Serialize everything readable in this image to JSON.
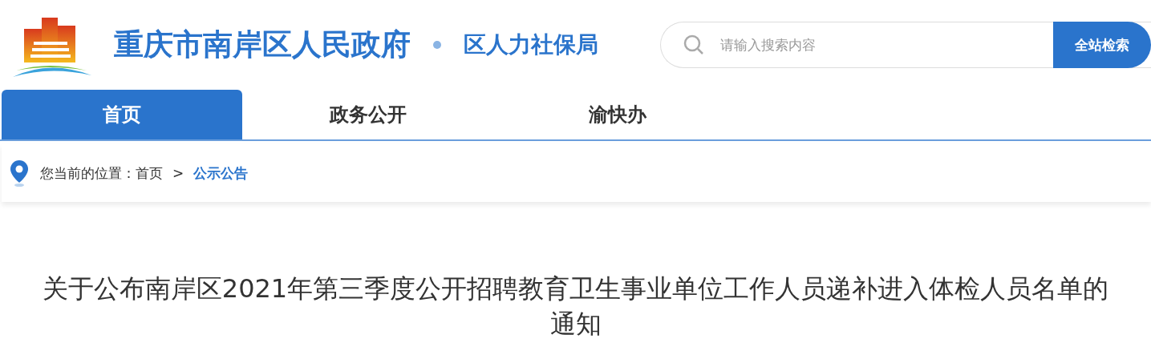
{
  "header": {
    "site_name": "重庆市南岸区人民政府",
    "department": "区人力社保局"
  },
  "search": {
    "placeholder": "请输入搜索内容",
    "button": "全站检索"
  },
  "nav": [
    {
      "label": "首页",
      "selected": true
    },
    {
      "label": "政务公开",
      "selected": false
    },
    {
      "label": "渝快办",
      "selected": false
    }
  ],
  "breadcrumb": {
    "prefix": "您当前的位置：",
    "items": [
      {
        "label": "首页",
        "current": false
      },
      {
        "label": "公示公告",
        "current": true
      }
    ],
    "separator": ">"
  },
  "article": {
    "title": "关于公布南岸区2021年第三季度公开招聘教育卫生事业单位工作人员递补进入体检人员名单的通知"
  }
}
